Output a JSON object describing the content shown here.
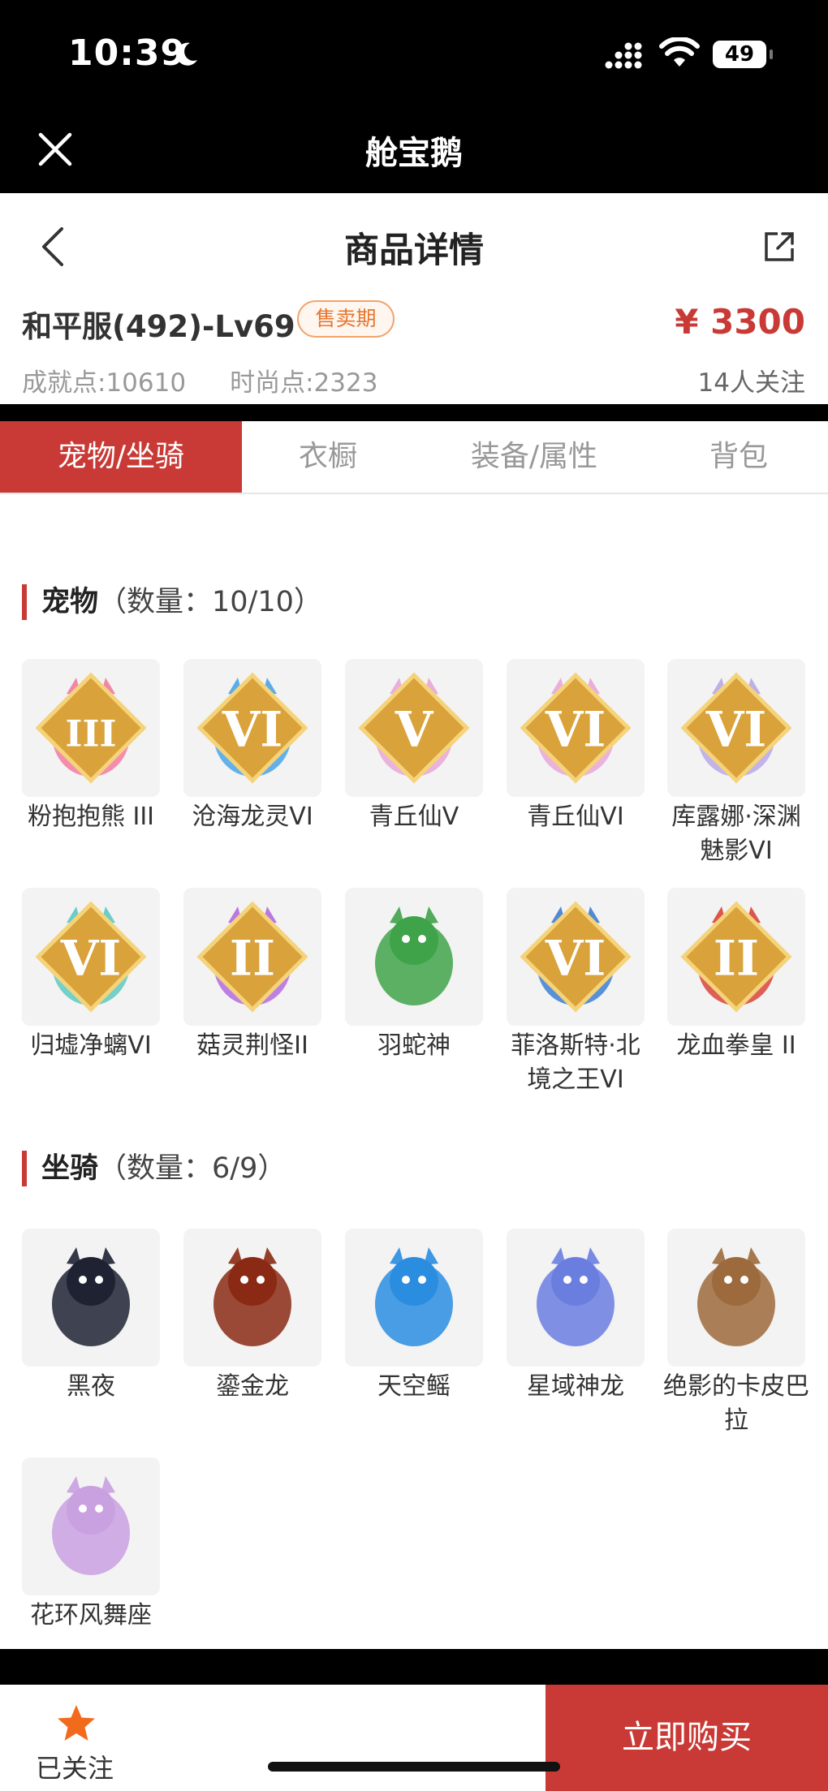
{
  "status_bar": {
    "time": "10:39",
    "battery": "49"
  },
  "app_bar": {
    "title": "舱宝鹅"
  },
  "nav": {
    "title": "商品详情"
  },
  "product": {
    "name": "和平服(492)-Lv69",
    "badge": "售卖期",
    "achievement_label": "成就点:",
    "achievement_value": "10610",
    "fashion_label": "时尚点:",
    "fashion_value": "2323",
    "price": "¥ 3300",
    "followers": "14人关注"
  },
  "tabs": [
    "宠物/坐骑",
    "衣橱",
    "装备/属性",
    "背包"
  ],
  "pets": {
    "title": "宠物",
    "count": "（数量：10/10）",
    "items": [
      {
        "name": "粉抱抱熊 III",
        "grade": "III",
        "icon": "pink-bear-icon",
        "color": "#f27aa0"
      },
      {
        "name": "沧海龙灵VI",
        "grade": "VI",
        "icon": "blue-dragon-spirit-icon",
        "color": "#4aa4e8"
      },
      {
        "name": "青丘仙V",
        "grade": "V",
        "icon": "fox-fairy-icon",
        "color": "#e8a6d8"
      },
      {
        "name": "青丘仙VI",
        "grade": "VI",
        "icon": "fox-fairy-icon",
        "color": "#e8a6d8"
      },
      {
        "name": "库露娜·深渊魅影VI",
        "grade": "VI",
        "icon": "abyss-phantom-icon",
        "color": "#b9a7e6"
      },
      {
        "name": "归墟净螭VI",
        "grade": "VI",
        "icon": "jade-dragon-icon",
        "color": "#5cc9c2"
      },
      {
        "name": "菇灵荆怪II",
        "grade": "II",
        "icon": "mushroom-sprite-icon",
        "color": "#b36ae0"
      },
      {
        "name": "羽蛇神",
        "grade": "",
        "icon": "feathered-serpent-icon",
        "color": "#3fa34a"
      },
      {
        "name": "菲洛斯特·北境之王VI",
        "grade": "VI",
        "icon": "frost-king-icon",
        "color": "#3c7fd1"
      },
      {
        "name": "龙血拳皇 II",
        "grade": "II",
        "icon": "dragon-blood-boxer-icon",
        "color": "#d8453a"
      }
    ]
  },
  "mounts": {
    "title": "坐骑",
    "count": "（数量：6/9）",
    "items": [
      {
        "name": "黑夜",
        "icon": "night-fury-icon",
        "color": "#1e2233"
      },
      {
        "name": "鎏金龙",
        "icon": "gilded-dragon-icon",
        "color": "#8a2a14"
      },
      {
        "name": "天空鳐",
        "icon": "sky-ray-icon",
        "color": "#2a8de0"
      },
      {
        "name": "星域神龙",
        "icon": "star-dragon-icon",
        "color": "#6a7ee0"
      },
      {
        "name": "绝影的卡皮巴拉",
        "icon": "capybara-icon",
        "color": "#9c6a3c"
      },
      {
        "name": "花环风舞座",
        "icon": "flower-wreath-icon",
        "color": "#c9a0e0"
      }
    ]
  },
  "bottom_bar": {
    "followed_label": "已关注",
    "buy_label": "立即购买"
  },
  "colors": {
    "accent": "#c93a36",
    "badge": "#e6762d",
    "star": "#f26b1d"
  }
}
